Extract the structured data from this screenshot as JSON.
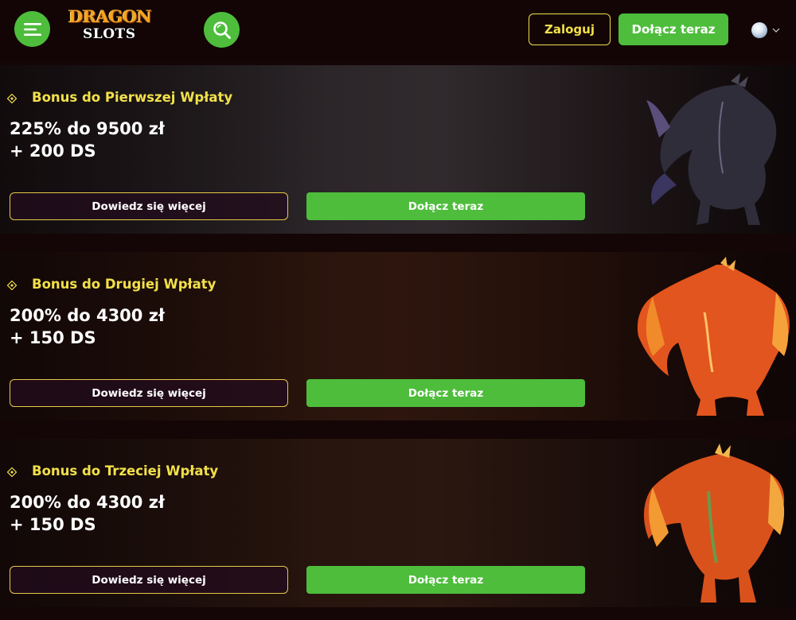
{
  "header": {
    "logo_line1": "DRAGON",
    "logo_line2": "SLOTS",
    "login_label": "Zaloguj",
    "join_label": "Dołącz teraz",
    "menu_icon": "hamburger-menu-icon",
    "search_icon": "search-icon",
    "language_icon": "globe-icon"
  },
  "bonuses": [
    {
      "title": "Bonus do Pierwszej Wpłaty",
      "amount_line1": "225% do 9500 zł",
      "amount_line2": "+ 200 DS",
      "more_label": "Dowiedz się więcej",
      "join_label": "Dołącz teraz",
      "dragon_color": "#3a3448"
    },
    {
      "title": "Bonus do Drugiej Wpłaty",
      "amount_line1": "200% do 4300 zł",
      "amount_line2": "+ 150 DS",
      "more_label": "Dowiedz się więcej",
      "join_label": "Dołącz teraz",
      "dragon_color": "#e2551e"
    },
    {
      "title": "Bonus do Trzeciej Wpłaty",
      "amount_line1": "200% do 4300 zł",
      "amount_line2": "+ 150 DS",
      "more_label": "Dowiedz się więcej",
      "join_label": "Dołącz teraz",
      "dragon_color": "#d9521c"
    }
  ],
  "colors": {
    "accent_green": "#4ebd3c",
    "accent_yellow": "#f2e04a",
    "background": "#140506"
  }
}
